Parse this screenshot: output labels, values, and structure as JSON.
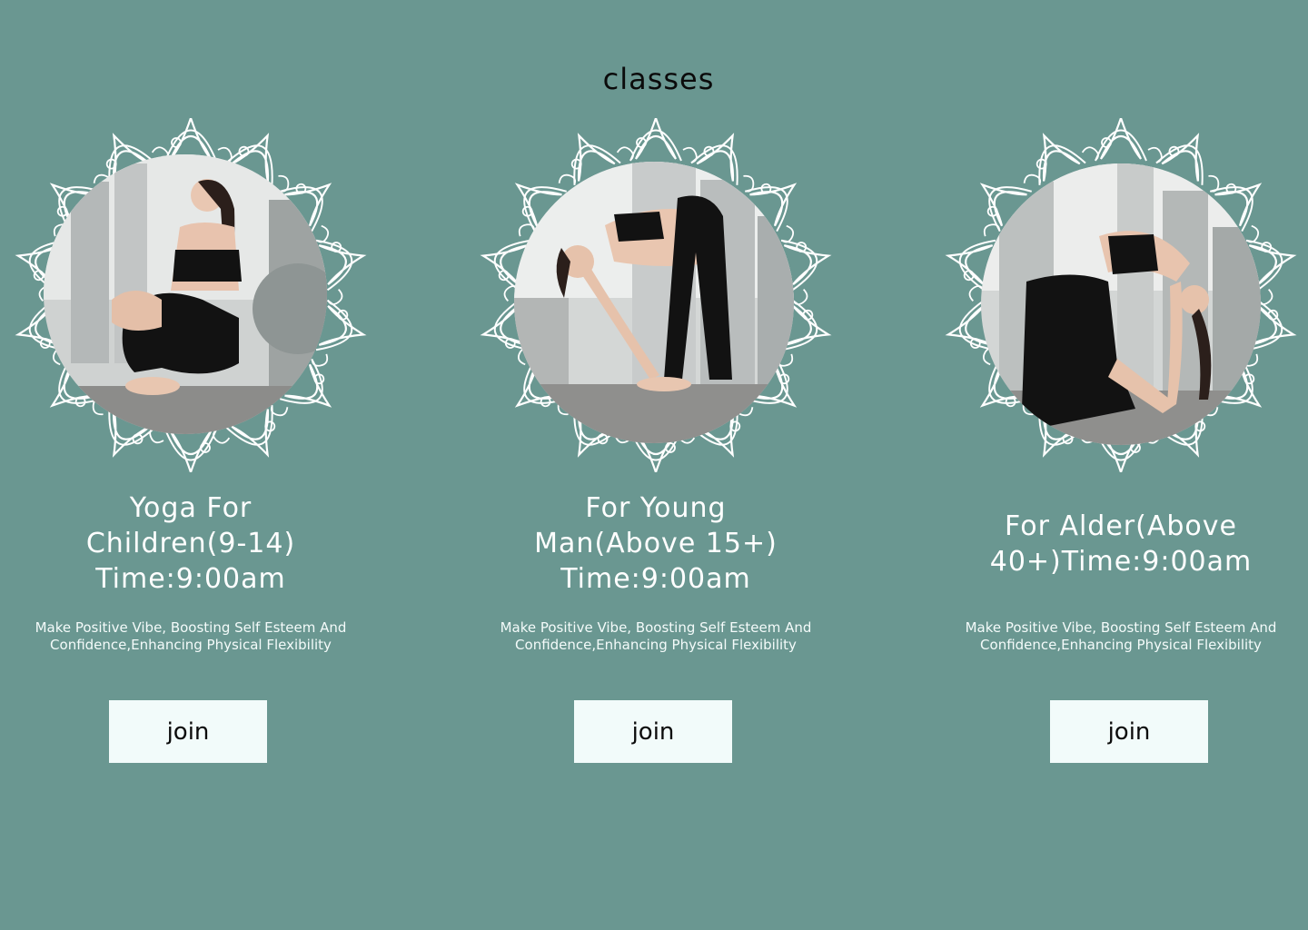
{
  "page": {
    "title": "classes"
  },
  "colors": {
    "background": "#6a9791",
    "button_background": "#f2fbfa",
    "mandala_stroke": "#ffffff"
  },
  "classes": [
    {
      "title_lines": [
        "Yoga For",
        "Children(9-14)",
        "Time:9:00am"
      ],
      "description_lines": [
        "Make Positive Vibe, Boosting Self Esteem And",
        "Confidence,Enhancing Physical Flexibility"
      ],
      "button_label": "join",
      "photo": "woman-sitting-meditating-yoga-photo"
    },
    {
      "title_lines": [
        "For Young",
        "Man(Above 15+)",
        "Time:9:00am"
      ],
      "description_lines": [
        "Make Positive Vibe, Boosting Self Esteem And",
        "Confidence,Enhancing Physical Flexibility"
      ],
      "button_label": "join",
      "photo": "woman-forward-bend-yoga-photo"
    },
    {
      "title_lines": [
        "For Alder(Above",
        "40+)Time:9:00am"
      ],
      "description_lines": [
        "Make Positive Vibe, Boosting Self Esteem And",
        "Confidence,Enhancing Physical Flexibility"
      ],
      "button_label": "join",
      "photo": "woman-camel-pose-yoga-photo"
    }
  ]
}
